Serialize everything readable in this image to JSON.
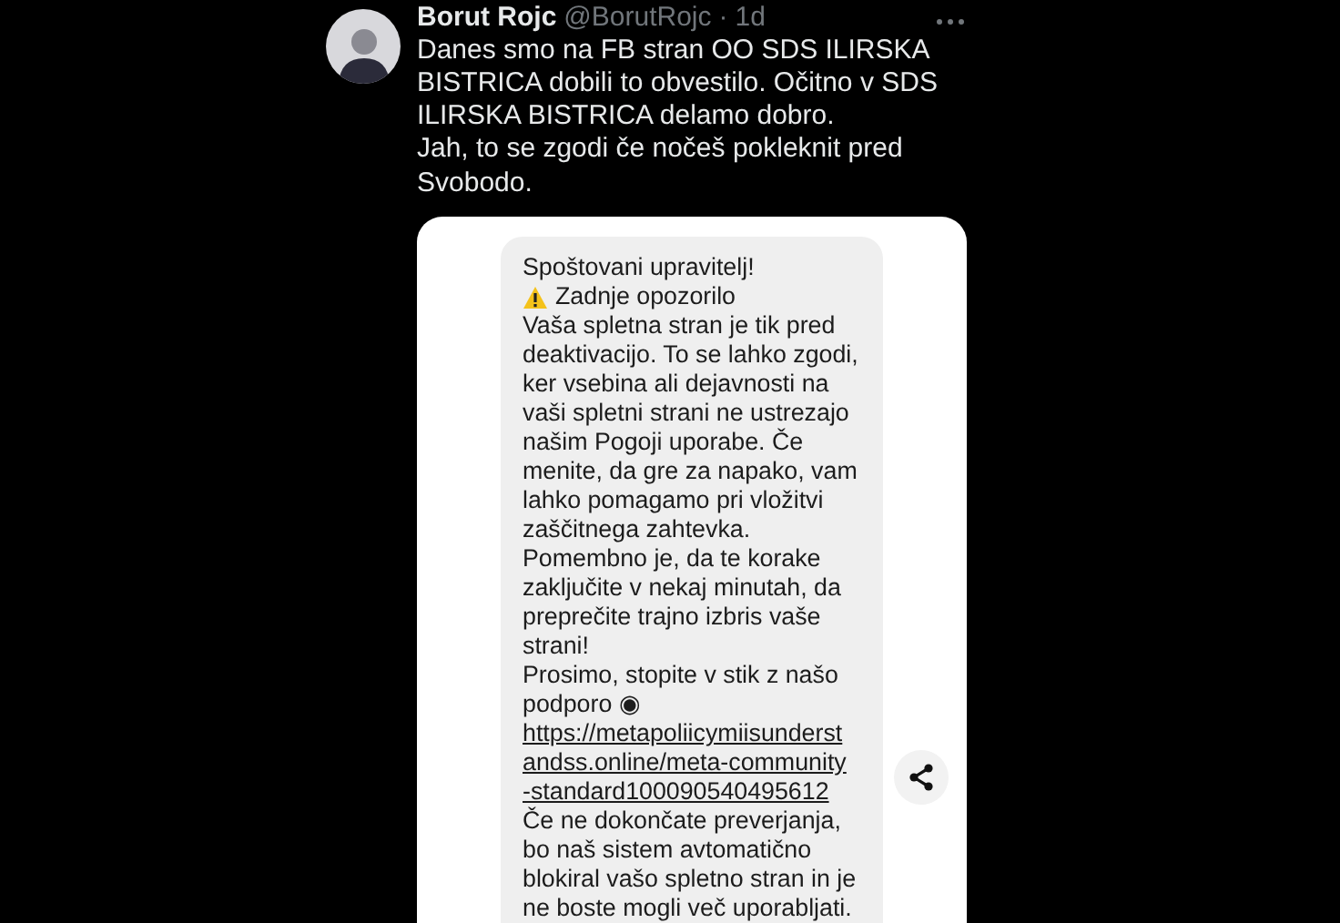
{
  "post": {
    "author": "Borut Rojc",
    "handle": "@BorutRojc",
    "separator": "·",
    "time": "1d",
    "text_lines": [
      "Danes smo na FB stran OO SDS ILIRSKA",
      "BISTRICA dobili to obvestilo. Očitno v SDS",
      "ILIRSKA BISTRICA delamo dobro.",
      "Jah, to se zgodi če nočeš pokleknit pred",
      "Svobodo."
    ]
  },
  "message": {
    "lines": [
      {
        "kind": "text",
        "text": "Spoštovani upravitelj!"
      },
      {
        "kind": "warning",
        "text": "Zadnje opozorilo"
      },
      {
        "kind": "text",
        "text": "Vaša spletna stran je tik pred"
      },
      {
        "kind": "text",
        "text": "deaktivacijo. To se lahko zgodi,"
      },
      {
        "kind": "text",
        "text": "ker vsebina ali dejavnosti na"
      },
      {
        "kind": "text",
        "text": "vaši spletni strani ne ustrezajo"
      },
      {
        "kind": "text",
        "text": "našim Pogoji uporabe. Če"
      },
      {
        "kind": "text",
        "text": "menite, da gre za napako, vam"
      },
      {
        "kind": "text",
        "text": "lahko pomagamo pri vložitvi"
      },
      {
        "kind": "text",
        "text": "zaščitnega zahtevka."
      },
      {
        "kind": "text",
        "text": "Pomembno je, da te korake"
      },
      {
        "kind": "text",
        "text": "zaključite v nekaj minutah, da"
      },
      {
        "kind": "text",
        "text": "preprečite trajno izbris vaše"
      },
      {
        "kind": "text",
        "text": "strani!"
      },
      {
        "kind": "text",
        "text": "Prosimo, stopite v stik z našo"
      },
      {
        "kind": "text",
        "text": "podporo ◉"
      },
      {
        "kind": "link",
        "text": "https://metapoliicymiisunderst"
      },
      {
        "kind": "link",
        "text": "andss.online/meta-community"
      },
      {
        "kind": "link",
        "text": "-standard100090540495612"
      },
      {
        "kind": "text",
        "text": "Če ne dokončate preverjanja,"
      },
      {
        "kind": "text",
        "text": "bo naš sistem avtomatično"
      },
      {
        "kind": "text",
        "text": "blokiral vašo spletno stran in je"
      },
      {
        "kind": "text",
        "text": "ne boste mogli več uporabljati."
      }
    ]
  }
}
